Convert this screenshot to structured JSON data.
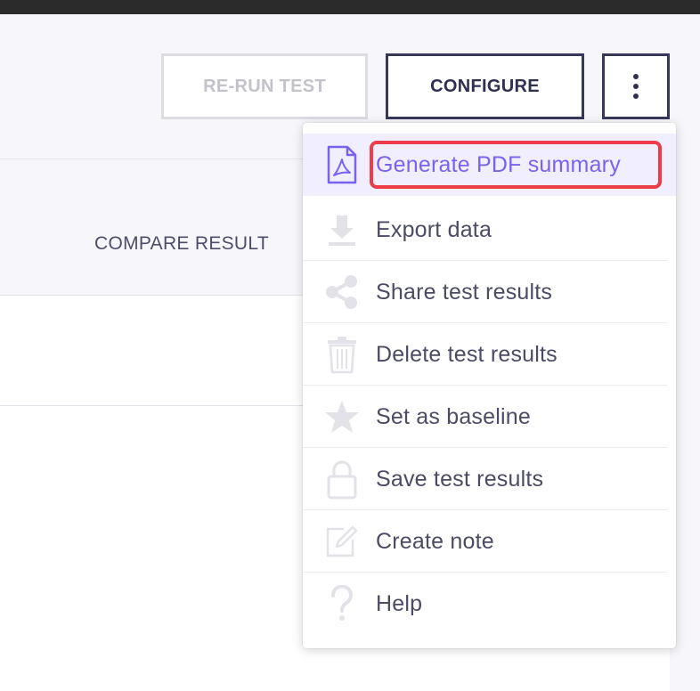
{
  "toolbar": {
    "rerun_label": "RE-RUN TEST",
    "configure_label": "CONFIGURE"
  },
  "table": {
    "compare_result_label": "COMPARE RESULT"
  },
  "menu": {
    "items": [
      {
        "label": "Generate PDF summary",
        "icon": "pdf-file-icon",
        "active": true,
        "highlighted": true
      },
      {
        "label": "Export data",
        "icon": "download-icon"
      },
      {
        "label": "Share test results",
        "icon": "share-icon"
      },
      {
        "label": "Delete test results",
        "icon": "trash-icon"
      },
      {
        "label": "Set as baseline",
        "icon": "star-icon"
      },
      {
        "label": "Save test results",
        "icon": "lock-icon"
      },
      {
        "label": "Create note",
        "icon": "edit-note-icon"
      },
      {
        "label": "Help",
        "icon": "question-icon"
      }
    ]
  },
  "colors": {
    "primary_dark": "#2f2f52",
    "accent_purple": "#7b61f0",
    "highlight_red": "#ec3d48",
    "disabled_gray": "#c2c2cc"
  }
}
